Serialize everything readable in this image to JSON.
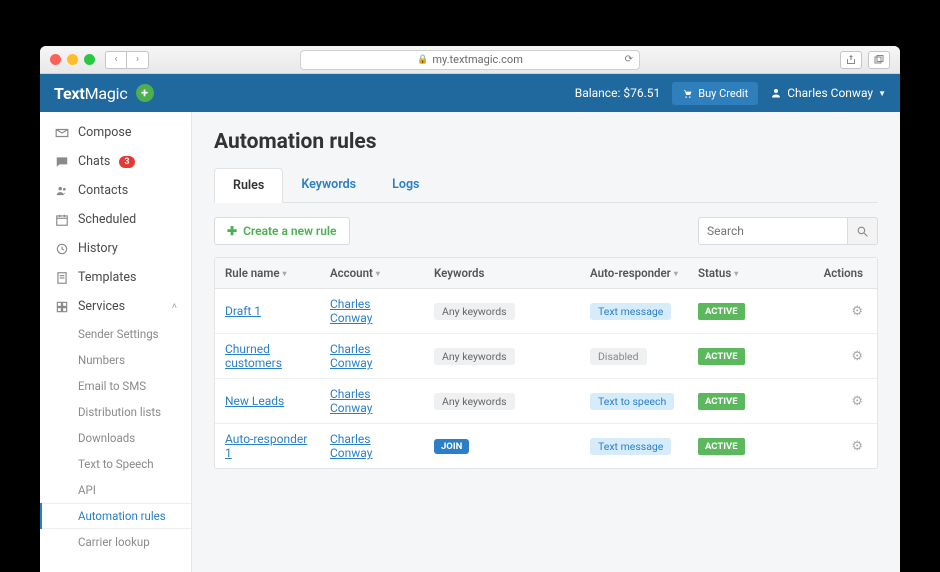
{
  "browser": {
    "url": "my.textmagic.com"
  },
  "header": {
    "logo_a": "Text",
    "logo_b": "Magic",
    "balance": "Balance: $76.51",
    "buy_credit": "Buy Credit",
    "user": "Charles Conway"
  },
  "sidebar": {
    "items": [
      {
        "icon": "compose",
        "label": "Compose"
      },
      {
        "icon": "chat",
        "label": "Chats",
        "badge": "3"
      },
      {
        "icon": "contacts",
        "label": "Contacts"
      },
      {
        "icon": "scheduled",
        "label": "Scheduled"
      },
      {
        "icon": "history",
        "label": "History"
      },
      {
        "icon": "templates",
        "label": "Templates"
      },
      {
        "icon": "services",
        "label": "Services",
        "expanded": true
      }
    ],
    "sub": [
      "Sender Settings",
      "Numbers",
      "Email to SMS",
      "Distribution lists",
      "Downloads",
      "Text to Speech",
      "API",
      "Automation rules",
      "Carrier lookup"
    ]
  },
  "page": {
    "title": "Automation rules",
    "tabs": [
      "Rules",
      "Keywords",
      "Logs"
    ],
    "create_label": "Create a new rule",
    "search_placeholder": "Search"
  },
  "table": {
    "headers": {
      "name": "Rule name",
      "account": "Account",
      "keywords": "Keywords",
      "responder": "Auto-responder",
      "status": "Status",
      "actions": "Actions"
    },
    "rows": [
      {
        "name": "Draft 1",
        "account": "Charles Conway",
        "kw": "Any keywords",
        "kw_kind": "gray",
        "responder": "Text message",
        "resp_kind": "blue",
        "status": "ACTIVE"
      },
      {
        "name": "Churned customers",
        "account": "Charles Conway",
        "kw": "Any keywords",
        "kw_kind": "gray",
        "responder": "Disabled",
        "resp_kind": "gray",
        "status": "ACTIVE"
      },
      {
        "name": "New Leads",
        "account": "Charles Conway",
        "kw": "Any keywords",
        "kw_kind": "gray",
        "responder": "Text to speech",
        "resp_kind": "blue",
        "status": "ACTIVE"
      },
      {
        "name": "Auto-responder 1",
        "account": "Charles Conway",
        "kw": "JOIN",
        "kw_kind": "join",
        "responder": "Text message",
        "resp_kind": "blue",
        "status": "ACTIVE"
      }
    ]
  }
}
